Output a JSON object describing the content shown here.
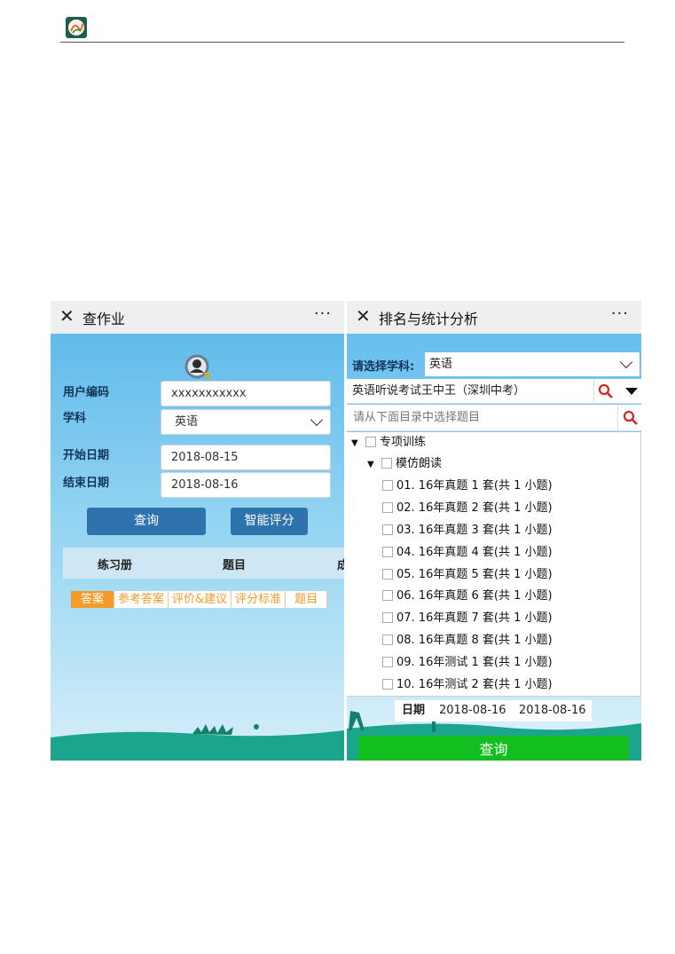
{
  "left": {
    "title": "查作业",
    "close_icon": "close-icon",
    "more_label": "···",
    "fields": {
      "user_code_label": "用户编码",
      "user_code_value": "xxxxxxxxxxx",
      "subject_label": "学科",
      "subject_value": "英语",
      "start_date_label": "开始日期",
      "start_date_value": "2018-08-15",
      "end_date_label": "结束日期",
      "end_date_value": "2018-08-16"
    },
    "buttons": {
      "query": "查询",
      "smart_score": "智能评分"
    },
    "table_headers": [
      "练习册",
      "题目",
      "成"
    ],
    "tabs": [
      "答案",
      "参考答案",
      "评价&建议",
      "评分标准",
      "题目"
    ]
  },
  "right": {
    "title": "排名与统计分析",
    "close_icon": "close-icon",
    "more_label": "···",
    "subject_label": "请选择学科:",
    "subject_value": "英语",
    "exam_value": "英语听说考试王中王（深圳中考）",
    "filter_placeholder": "请从下面目录中选择题目",
    "tree": {
      "root": "专项训练",
      "child": "模仿朗读",
      "items": [
        "01. 16年真题 1 套(共 1 小题)",
        "02. 16年真题 2 套(共 1 小题)",
        "03. 16年真题 3 套(共 1 小题)",
        "04. 16年真题 4 套(共 1 小题)",
        "05. 16年真题 5 套(共 1 小题)",
        "06. 16年真题 6 套(共 1 小题)",
        "07. 16年真题 7 套(共 1 小题)",
        "08. 16年真题 8 套(共 1 小题)",
        "09. 16年测试 1 套(共 1 小题)",
        "10. 16年测试 2 套(共 1 小题)"
      ]
    },
    "date_row": {
      "label": "日期",
      "start": "2018-08-16",
      "end": "2018-08-16"
    },
    "query_button": "查询"
  },
  "colors": {
    "sky": "#58b7ea",
    "primary_button": "#2f73ad",
    "green_button": "#13bf1e",
    "tab_orange": "#f39b2b",
    "ground_teal": "#1aa58c"
  }
}
